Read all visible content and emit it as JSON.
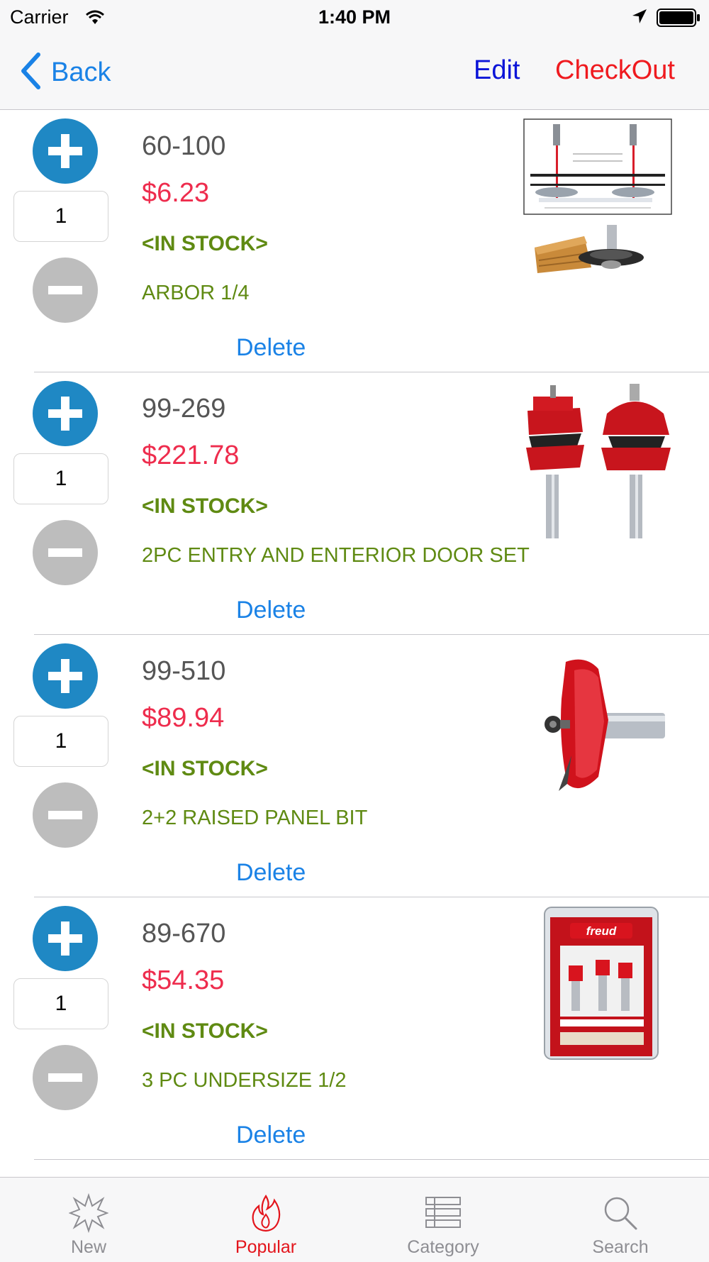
{
  "status_bar": {
    "carrier": "Carrier",
    "time": "1:40 PM"
  },
  "nav": {
    "back_label": "Back",
    "edit_label": "Edit",
    "checkout_label": "CheckOut"
  },
  "colors": {
    "back_blue": "#1a82e6",
    "edit_blue": "#0b14d8",
    "checkout_red": "#ef1a1f",
    "price_red": "#ee2c4d",
    "stock_green": "#5f8a12",
    "plus_blue": "#1f88c4",
    "minus_gray": "#bdbdbd",
    "tab_active": "#e3151c"
  },
  "cart": {
    "items": [
      {
        "sku": "60-100",
        "price": "$6.23",
        "stock": "<IN STOCK>",
        "description": "ARBOR 1/4",
        "quantity": "1",
        "delete_label": "Delete",
        "image": "arbor-diagram-and-cutter"
      },
      {
        "sku": "99-269",
        "price": "$221.78",
        "stock": "<IN STOCK>",
        "description": "2PC ENTRY AND ENTERIOR DOOR SET",
        "quantity": "1",
        "delete_label": "Delete",
        "image": "two-red-router-bits"
      },
      {
        "sku": "99-510",
        "price": "$89.94",
        "stock": "<IN STOCK>",
        "description": "2+2 RAISED PANEL BIT",
        "quantity": "1",
        "delete_label": "Delete",
        "image": "red-panel-raising-bit"
      },
      {
        "sku": "89-670",
        "price": "$54.35",
        "stock": "<IN STOCK>",
        "description": "3 PC UNDERSIZE 1/2",
        "quantity": "1",
        "delete_label": "Delete",
        "image": "boxed-three-bit-set"
      }
    ]
  },
  "product_box_brand": "freud",
  "tabs": [
    {
      "label": "New",
      "icon": "starburst-icon",
      "active": false
    },
    {
      "label": "Popular",
      "icon": "flame-icon",
      "active": true
    },
    {
      "label": "Category",
      "icon": "list-icon",
      "active": false
    },
    {
      "label": "Search",
      "icon": "magnifier-icon",
      "active": false
    }
  ]
}
